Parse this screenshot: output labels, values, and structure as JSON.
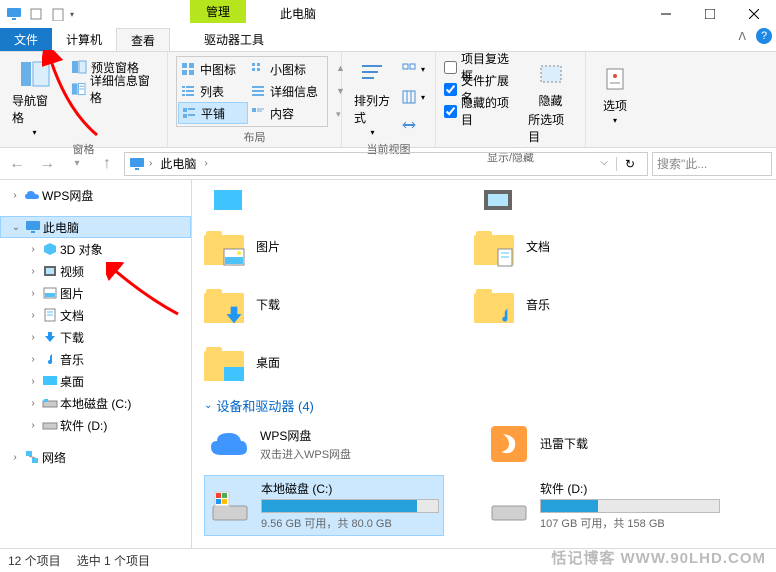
{
  "title": "此电脑",
  "titlebar_tab": "管理",
  "tabs": {
    "file": "文件",
    "computer": "计算机",
    "view": "查看",
    "drive_tools": "驱动器工具"
  },
  "ribbon": {
    "panes": {
      "nav_pane": "导航窗格",
      "preview_pane": "预览窗格",
      "details_pane": "详细信息窗格",
      "label": "窗格"
    },
    "layout": {
      "medium_icons": "中图标",
      "small_icons": "小图标",
      "list": "列表",
      "details": "详细信息",
      "tiles": "平铺",
      "content": "内容",
      "label": "布局"
    },
    "current_view": {
      "sort": "排列方式",
      "label": "当前视图"
    },
    "show_hide": {
      "item_checkboxes": "项目复选框",
      "extensions": "文件扩展名",
      "hidden_items": "隐藏的项目",
      "hide": "隐藏",
      "hide_sub": "所选项目",
      "label": "显示/隐藏"
    },
    "options": "选项"
  },
  "address": {
    "root": "此电脑",
    "search_placeholder": "搜索\"此..."
  },
  "tree": {
    "wps": "WPS网盘",
    "this_pc": "此电脑",
    "items": [
      "3D 对象",
      "视频",
      "图片",
      "文档",
      "下载",
      "音乐",
      "桌面",
      "本地磁盘 (C:)",
      "软件 (D:)"
    ],
    "network": "网络"
  },
  "folders": {
    "pictures": "图片",
    "documents": "文档",
    "downloads": "下载",
    "music": "音乐",
    "desktop": "桌面"
  },
  "section_devices": "设备和驱动器 (4)",
  "drives": {
    "wps": {
      "name": "WPS网盘",
      "sub": "双击进入WPS网盘"
    },
    "xunlei": {
      "name": "迅雷下载"
    },
    "c": {
      "name": "本地磁盘 (C:)",
      "text": "9.56 GB 可用，共 80.0 GB",
      "fill": 88
    },
    "d": {
      "name": "软件 (D:)",
      "text": "107 GB 可用，共 158 GB",
      "fill": 32
    }
  },
  "status": {
    "count": "12 个项目",
    "selected": "选中 1 个项目"
  },
  "watermark": "恬记博客 WWW.90LHD.COM"
}
